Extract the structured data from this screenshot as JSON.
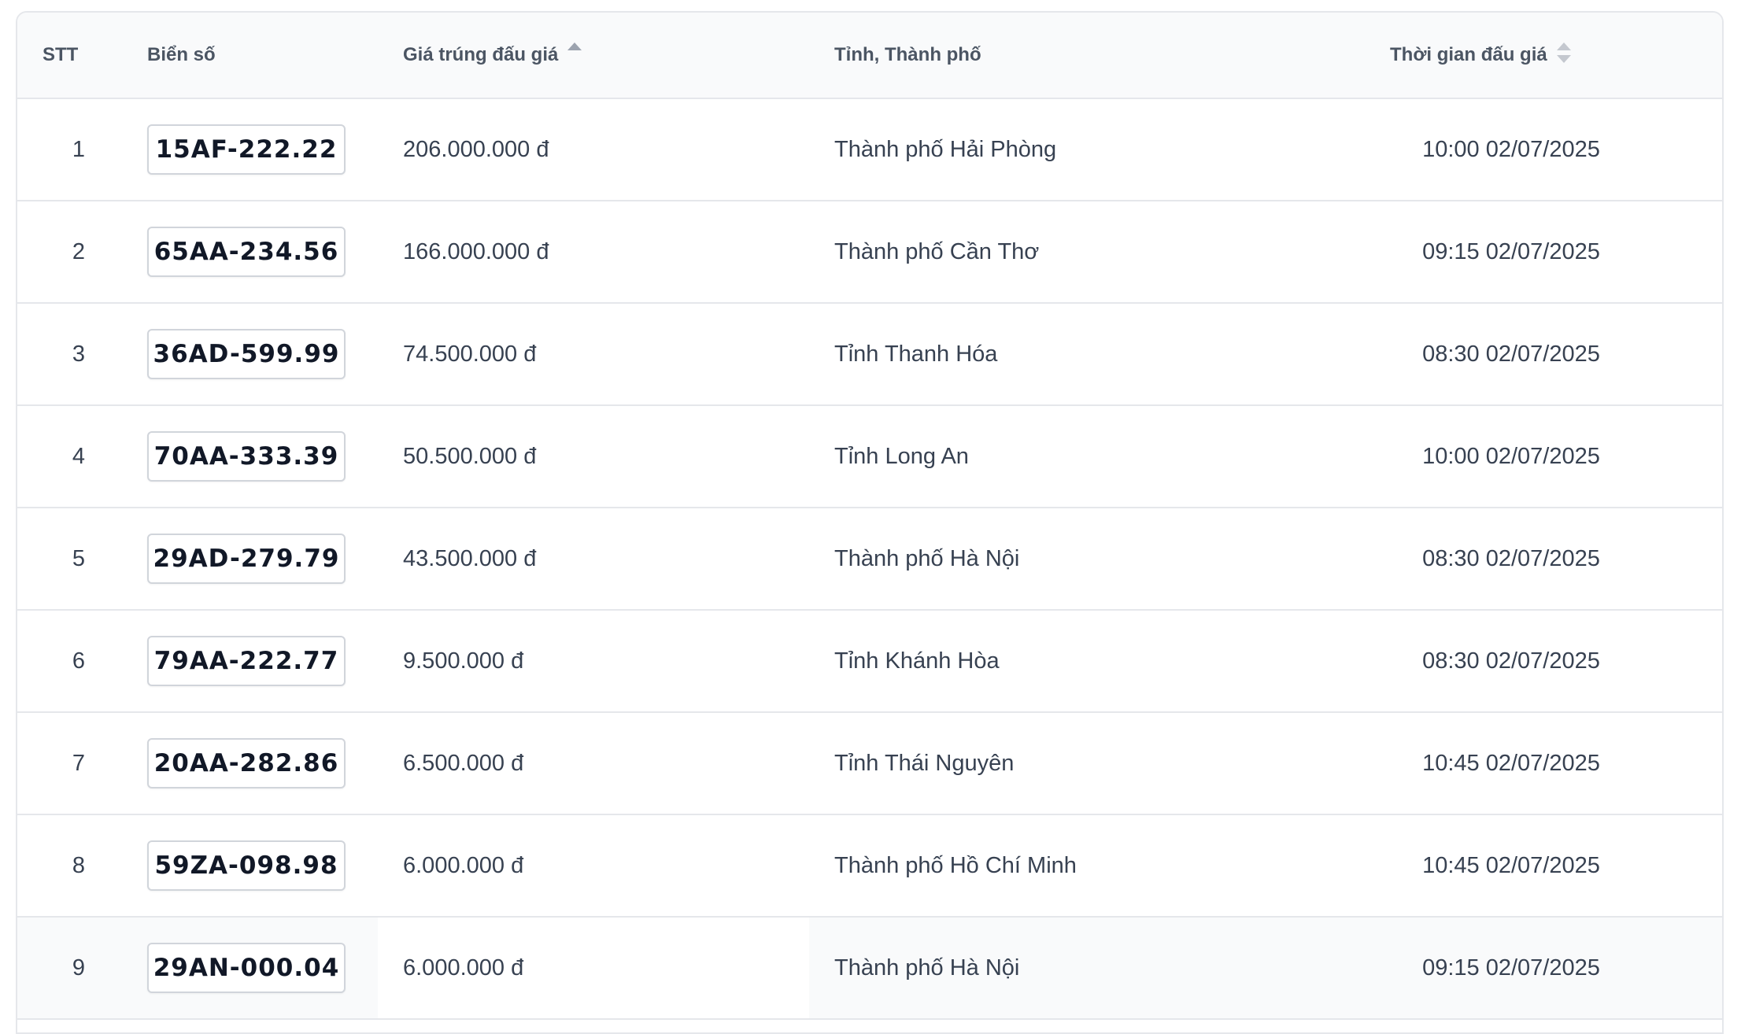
{
  "table": {
    "headers": {
      "stt": "STT",
      "plate": "Biển số",
      "price": "Giá trúng đấu giá",
      "province": "Tỉnh, Thành phố",
      "time": "Thời gian đấu giá"
    },
    "rows": [
      {
        "stt": "1",
        "plate": "15AF-222.22",
        "price": "206.000.000 đ",
        "province": "Thành phố Hải Phòng",
        "time": "10:00 02/07/2025"
      },
      {
        "stt": "2",
        "plate": "65AA-234.56",
        "price": "166.000.000 đ",
        "province": "Thành phố Cần Thơ",
        "time": "09:15 02/07/2025"
      },
      {
        "stt": "3",
        "plate": "36AD-599.99",
        "price": "74.500.000 đ",
        "province": "Tỉnh Thanh Hóa",
        "time": "08:30 02/07/2025"
      },
      {
        "stt": "4",
        "plate": "70AA-333.39",
        "price": "50.500.000 đ",
        "province": "Tỉnh Long An",
        "time": "10:00 02/07/2025"
      },
      {
        "stt": "5",
        "plate": "29AD-279.79",
        "price": "43.500.000 đ",
        "province": "Thành phố Hà Nội",
        "time": "08:30 02/07/2025"
      },
      {
        "stt": "6",
        "plate": "79AA-222.77",
        "price": "9.500.000 đ",
        "province": "Tỉnh Khánh Hòa",
        "time": "08:30 02/07/2025"
      },
      {
        "stt": "7",
        "plate": "20AA-282.86",
        "price": "6.500.000 đ",
        "province": "Tỉnh Thái Nguyên",
        "time": "10:45 02/07/2025"
      },
      {
        "stt": "8",
        "plate": "59ZA-098.98",
        "price": "6.000.000 đ",
        "province": "Thành phố Hồ Chí Minh",
        "time": "10:45 02/07/2025"
      },
      {
        "stt": "9",
        "plate": "29AN-000.04",
        "price": "6.000.000 đ",
        "province": "Thành phố Hà Nội",
        "time": "09:15 02/07/2025"
      }
    ]
  },
  "icons": {
    "price_sort": "sort-ascending-icon",
    "time_sort": "sort-icon"
  },
  "colors": {
    "border": "#e5e7eb",
    "header_bg": "#f9fafb",
    "text": "#374151"
  }
}
